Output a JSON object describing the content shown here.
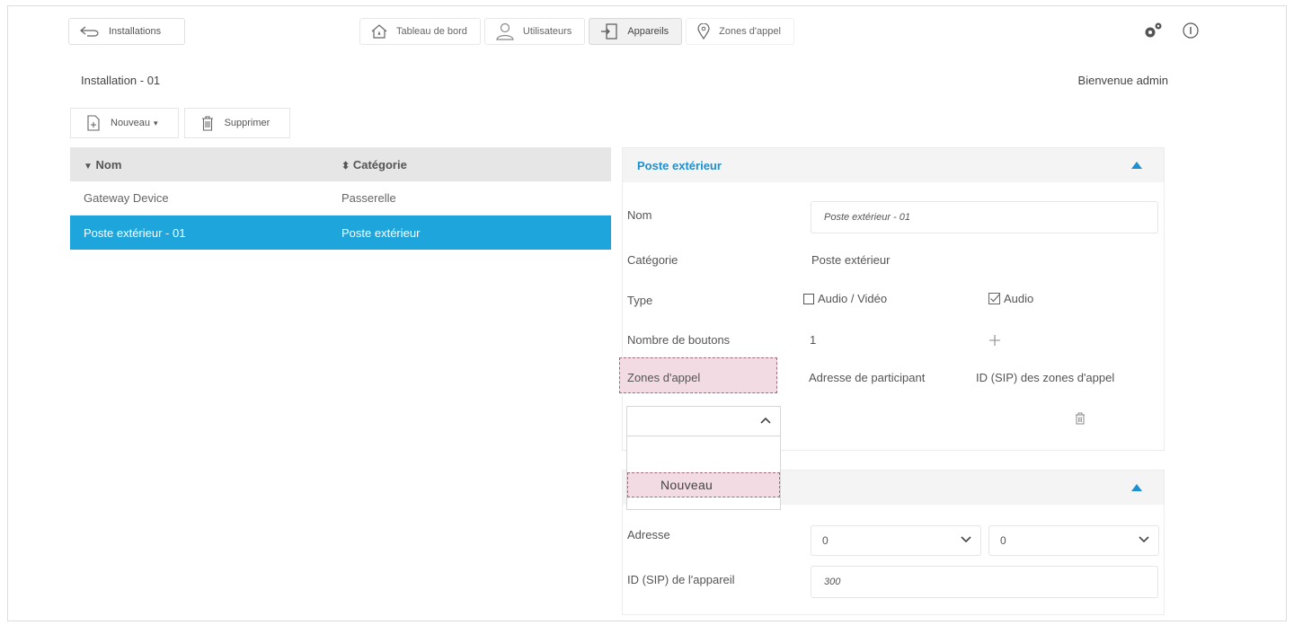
{
  "topbar": {
    "back_label": "Installations",
    "nav": [
      {
        "label": "Tableau de bord",
        "icon": "home-icon"
      },
      {
        "label": "Utilisateurs",
        "icon": "user-icon"
      },
      {
        "label": "Appareils",
        "icon": "device-icon",
        "active": true
      },
      {
        "label": "Zones d'appel",
        "icon": "location-pin-icon"
      }
    ],
    "settings_icon": "gears-icon",
    "info_icon": "info-icon"
  },
  "page": {
    "installation_title": "Installation - 01",
    "welcome": "Bienvenue admin"
  },
  "toolbar": {
    "new_label": "Nouveau",
    "delete_label": "Supprimer"
  },
  "table": {
    "columns": [
      "Nom",
      "Catégorie"
    ],
    "rows": [
      {
        "name": "Gateway Device",
        "category": "Passerelle",
        "selected": false
      },
      {
        "name": "Poste extérieur - 01",
        "category": "Poste extérieur",
        "selected": true
      }
    ]
  },
  "panel1": {
    "title": "Poste extérieur",
    "name_label": "Nom",
    "name_value": "Poste extérieur - 01",
    "category_label": "Catégorie",
    "category_value": "Poste extérieur",
    "type_label": "Type",
    "type_opt1": "Audio / Vidéo",
    "type_opt1_checked": false,
    "type_opt2": "Audio",
    "type_opt2_checked": true,
    "buttons_label": "Nombre de boutons",
    "buttons_value": "1",
    "zones_label": "Zones d'appel",
    "participant_header": "Adresse de participant",
    "sip_zone_header": "ID (SIP) des zones d'appel",
    "dropdown_option": "Nouveau"
  },
  "panel2": {
    "address_label": "Adresse",
    "address_value1": "0",
    "address_value2": "0",
    "sip_label": "ID (SIP) de l'appareil",
    "sip_value": "300"
  },
  "colors": {
    "accent": "#1ea6dc",
    "panel_title": "#1e90cf",
    "highlight": "#f2dbe2"
  }
}
